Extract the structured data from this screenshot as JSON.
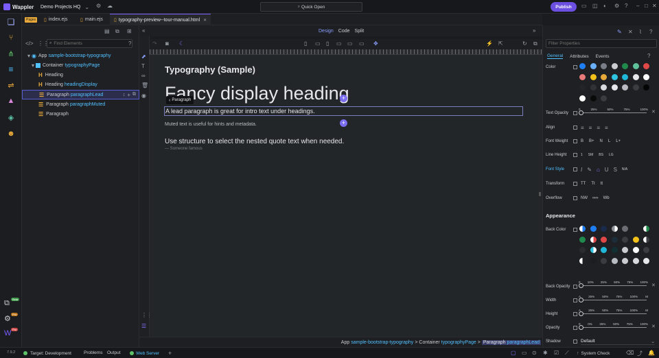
{
  "app": {
    "name": "Wappler",
    "project": "Demo Projects HQ",
    "quick_open": "Quick Open",
    "publish": "Publish"
  },
  "tabs": {
    "pages_badge": "Pages",
    "items": [
      {
        "label": "index.ejs"
      },
      {
        "label": "main.ejs"
      },
      {
        "label": "typography-preview--tour-manual.html",
        "active": true
      }
    ]
  },
  "structure": {
    "search_placeholder": "Find Elements",
    "tree": [
      {
        "label": "App",
        "sub": "sample-bootstrap-typography"
      },
      {
        "label": "Container",
        "sub": "typographyPage"
      },
      {
        "icon": "H",
        "label": "Heading",
        "sub": ""
      },
      {
        "icon": "H",
        "label": "Heading",
        "sub": "headingDisplay"
      },
      {
        "icon": "P",
        "label": "Paragraph",
        "sub": "paragraphLead",
        "selected": true
      },
      {
        "icon": "P",
        "label": "Paragraph",
        "sub": "paragraphMuted"
      },
      {
        "icon": "P",
        "label": "Paragraph",
        "sub": ""
      }
    ]
  },
  "design": {
    "modes": [
      "Design",
      "Code",
      "Split"
    ],
    "active_mode": "Design"
  },
  "canvas": {
    "page_title": "Typography (Sample)",
    "display_heading": "Fancy display heading",
    "selection_tag": "Paragraph",
    "lead": "A lead paragraph is great for intro text under headings.",
    "muted": "Muted text is useful for hints and metadata.",
    "quote": "Use structure to select the nested quote text when needed.",
    "quote_footer": "— Someone famous"
  },
  "breadcrumb": {
    "app": "App",
    "app_sub": "sample-bootstrap-typography",
    "sep": ">",
    "container": "Container",
    "container_sub": "typographyPage",
    "current": "Paragraph",
    "current_sub": "paragraphLead"
  },
  "props": {
    "filter_placeholder": "Filter Properties",
    "tabs": [
      "General",
      "Attributes",
      "Events"
    ],
    "active_tab": "General",
    "color_label": "Color",
    "text_opacity_label": "Text Opacity",
    "align_label": "Align",
    "font_weight_label": "Font Weight",
    "font_weight_opts": [
      "B",
      "B+",
      "N",
      "L",
      "L+"
    ],
    "line_height_label": "Line Height",
    "line_height_opts": [
      "1",
      "SM",
      "BS",
      "LG"
    ],
    "font_style_label": "Font Style",
    "font_style_na": "N/A",
    "transform_label": "Transform",
    "transform_opts": [
      "TT",
      "Tt",
      "tt"
    ],
    "overflow_label": "Overflow",
    "overflow_opts": [
      "NW",
      "∞∞",
      "Wb"
    ],
    "appearance_title": "Appearance",
    "back_color_label": "Back Color",
    "back_opacity_label": "Back Opacity",
    "width_label": "Width",
    "height_label": "Height",
    "opacity_label": "Opacity",
    "shadow_label": "Shadow",
    "shadow_value": "Default",
    "ticks_text_opacity": [
      "0",
      "25%",
      "50%",
      "75%",
      "100%"
    ],
    "ticks_back_opacity": [
      "0",
      "10%",
      "25%",
      "50%",
      "75%",
      "100%"
    ],
    "ticks_size": [
      "A",
      "25%",
      "50%",
      "75%",
      "100%",
      "M"
    ],
    "ticks_opacity": [
      "0",
      "0%",
      "25%",
      "50%",
      "75%",
      "100%"
    ]
  },
  "status": {
    "version": "7.9.2",
    "target": "Target: Development",
    "problems": "Problems",
    "output": "Output",
    "web_server": "Web Server",
    "system_check": "System Check",
    "rail_badge_beta": "Beta",
    "rail_badge_pro": "Pro",
    "rail_badge_new": "Pro"
  },
  "colors": {
    "accent": "#7a5cff",
    "selection": "#7a6df0",
    "link": "#52c1ff"
  }
}
